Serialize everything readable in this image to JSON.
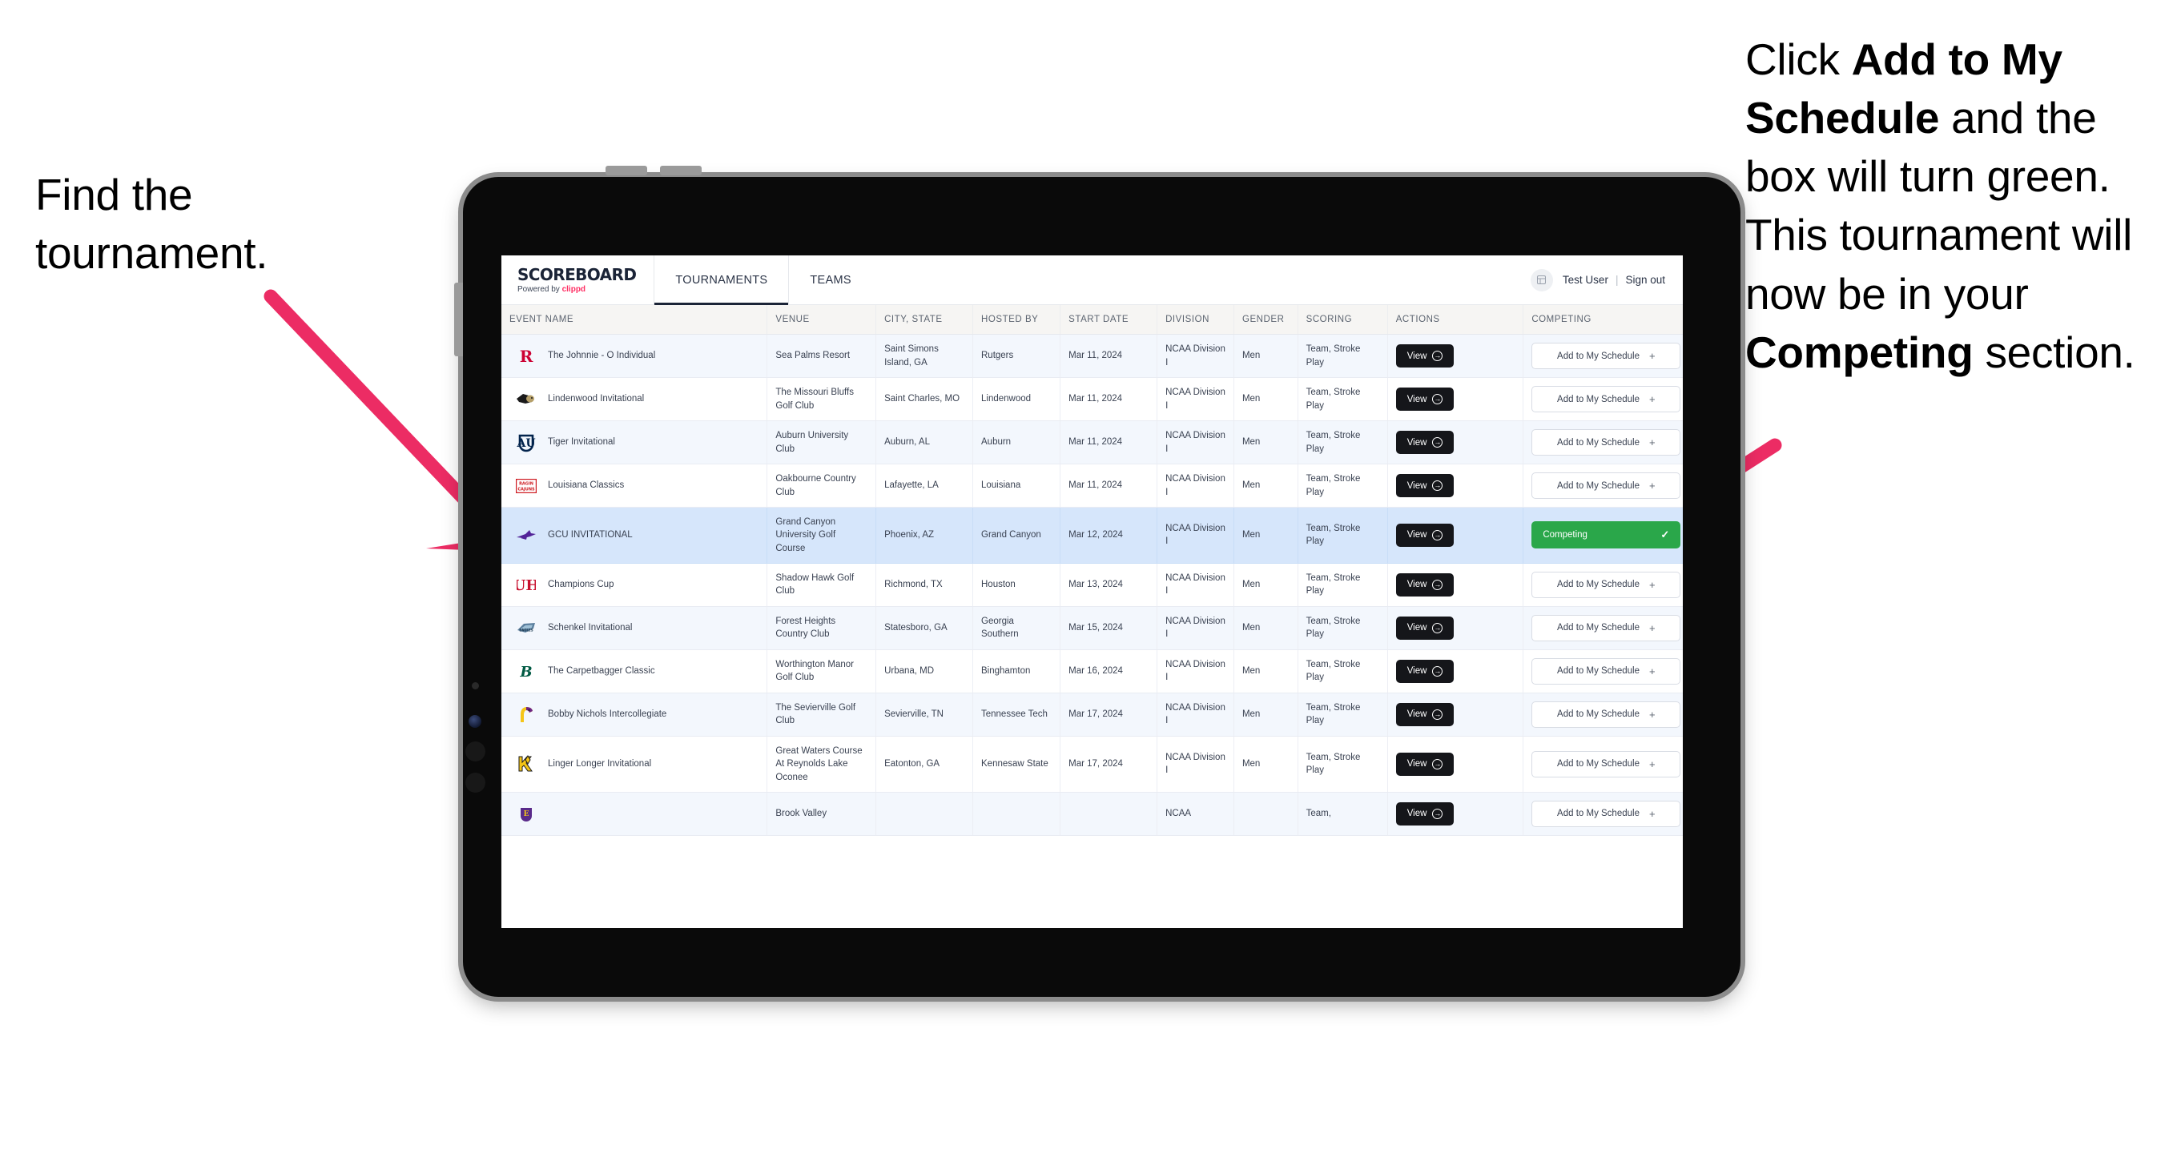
{
  "annotations": {
    "left": "Find the tournament.",
    "right_parts": [
      {
        "text": "Click ",
        "bold": false
      },
      {
        "text": "Add to My Schedule",
        "bold": true
      },
      {
        "text": " and the box will turn green. This tournament will now be in your ",
        "bold": false
      },
      {
        "text": "Competing",
        "bold": true
      },
      {
        "text": " section.",
        "bold": false
      }
    ],
    "arrow_color": "#EC2C64"
  },
  "app": {
    "brand": {
      "name": "SCOREBOARD",
      "powered_prefix": "Powered by ",
      "powered_brand": "clippd"
    },
    "nav": [
      {
        "label": "TOURNAMENTS",
        "active": true
      },
      {
        "label": "TEAMS",
        "active": false
      }
    ],
    "header_right": {
      "app_badge_icon": "grid-icon",
      "user": "Test User",
      "separator": "|",
      "sign_out": "Sign out"
    },
    "accent_green": "#2aa74a",
    "selected_row_color": "#d6e6fb"
  },
  "table": {
    "columns": [
      "EVENT NAME",
      "VENUE",
      "CITY, STATE",
      "HOSTED BY",
      "START DATE",
      "DIVISION",
      "GENDER",
      "SCORING",
      "ACTIONS",
      "COMPETING"
    ],
    "view_label": "View",
    "add_label": "Add to My Schedule",
    "competing_label": "Competing",
    "rows": [
      {
        "logo": "rutgers-logo",
        "event": "The Johnnie - O Individual",
        "venue": "Sea Palms Resort",
        "city": "Saint Simons Island, GA",
        "host": "Rutgers",
        "date": "Mar 11, 2024",
        "division": "NCAA Division I",
        "gender": "Men",
        "scoring": "Team, Stroke Play",
        "competing": false
      },
      {
        "logo": "lindenwood-logo",
        "event": "Lindenwood Invitational",
        "venue": "The Missouri Bluffs Golf Club",
        "city": "Saint Charles, MO",
        "host": "Lindenwood",
        "date": "Mar 11, 2024",
        "division": "NCAA Division I",
        "gender": "Men",
        "scoring": "Team, Stroke Play",
        "competing": false
      },
      {
        "logo": "auburn-logo",
        "event": "Tiger Invitational",
        "venue": "Auburn University Club",
        "city": "Auburn, AL",
        "host": "Auburn",
        "date": "Mar 11, 2024",
        "division": "NCAA Division I",
        "gender": "Men",
        "scoring": "Team, Stroke Play",
        "competing": false
      },
      {
        "logo": "louisiana-logo",
        "event": "Louisiana Classics",
        "venue": "Oakbourne Country Club",
        "city": "Lafayette, LA",
        "host": "Louisiana",
        "date": "Mar 11, 2024",
        "division": "NCAA Division I",
        "gender": "Men",
        "scoring": "Team, Stroke Play",
        "competing": false
      },
      {
        "logo": "gcu-logo",
        "event": "GCU INVITATIONAL",
        "venue": "Grand Canyon University Golf Course",
        "city": "Phoenix, AZ",
        "host": "Grand Canyon",
        "date": "Mar 12, 2024",
        "division": "NCAA Division I",
        "gender": "Men",
        "scoring": "Team, Stroke Play",
        "competing": true
      },
      {
        "logo": "houston-logo",
        "event": "Champions Cup",
        "venue": "Shadow Hawk Golf Club",
        "city": "Richmond, TX",
        "host": "Houston",
        "date": "Mar 13, 2024",
        "division": "NCAA Division I",
        "gender": "Men",
        "scoring": "Team, Stroke Play",
        "competing": false
      },
      {
        "logo": "georgia-southern-logo",
        "event": "Schenkel Invitational",
        "venue": "Forest Heights Country Club",
        "city": "Statesboro, GA",
        "host": "Georgia Southern",
        "date": "Mar 15, 2024",
        "division": "NCAA Division I",
        "gender": "Men",
        "scoring": "Team, Stroke Play",
        "competing": false
      },
      {
        "logo": "binghamton-logo",
        "event": "The Carpetbagger Classic",
        "venue": "Worthington Manor Golf Club",
        "city": "Urbana, MD",
        "host": "Binghamton",
        "date": "Mar 16, 2024",
        "division": "NCAA Division I",
        "gender": "Men",
        "scoring": "Team, Stroke Play",
        "competing": false
      },
      {
        "logo": "tennessee-tech-logo",
        "event": "Bobby Nichols Intercollegiate",
        "venue": "The Sevierville Golf Club",
        "city": "Sevierville, TN",
        "host": "Tennessee Tech",
        "date": "Mar 17, 2024",
        "division": "NCAA Division I",
        "gender": "Men",
        "scoring": "Team, Stroke Play",
        "competing": false
      },
      {
        "logo": "kennesaw-logo",
        "event": "Linger Longer Invitational",
        "venue": "Great Waters Course At Reynolds Lake Oconee",
        "city": "Eatonton, GA",
        "host": "Kennesaw State",
        "date": "Mar 17, 2024",
        "division": "NCAA Division I",
        "gender": "Men",
        "scoring": "Team, Stroke Play",
        "competing": false
      },
      {
        "logo": "ecu-logo",
        "event": "",
        "venue": "Brook Valley",
        "city": "",
        "host": "",
        "date": "",
        "division": "NCAA",
        "gender": "",
        "scoring": "Team,",
        "competing": false
      }
    ]
  }
}
